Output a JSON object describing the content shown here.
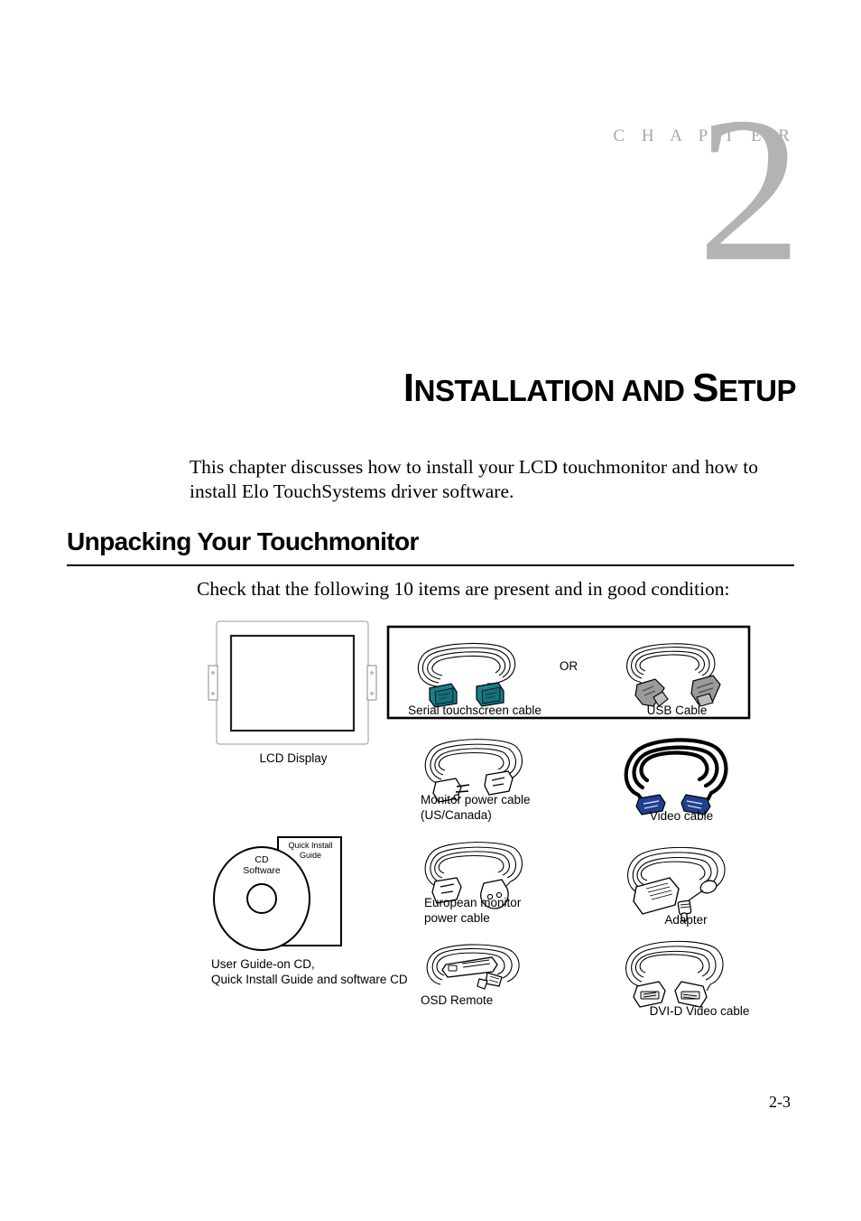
{
  "document": {
    "chapter_label": "C H A P T E R",
    "chapter_number": "2",
    "chapter_title_part1": "I",
    "chapter_title_part1_rest": "NSTALLATION AND ",
    "chapter_title_part2": "S",
    "chapter_title_part2_rest": "ETUP",
    "chapter_title_full": "INSTALLATION AND SETUP",
    "intro_paragraph": "This chapter discusses how to install your LCD touchmonitor and how to install Elo TouchSystems driver software.",
    "section_heading": "Unpacking Your Touchmonitor",
    "check_line": "Check that the following 10 items are present and in good condition:",
    "page_number": "2-3"
  },
  "illustration": {
    "or_label": "OR",
    "items": [
      {
        "id": "lcd-display",
        "caption": "LCD Display"
      },
      {
        "id": "serial-cable",
        "caption": "Serial touchscreen cable"
      },
      {
        "id": "usb-cable",
        "caption": "USB Cable"
      },
      {
        "id": "monitor-power",
        "caption": "Monitor power cable\n(US/Canada)"
      },
      {
        "id": "video-cable",
        "caption": "Video cable"
      },
      {
        "id": "european-power",
        "caption": "European monitor\npower cable"
      },
      {
        "id": "adapter",
        "caption": "Adapter"
      },
      {
        "id": "osd-remote",
        "caption": "OSD Remote"
      },
      {
        "id": "dvi-cable",
        "caption": "DVI-D Video cable"
      },
      {
        "id": "cd-software",
        "caption": "User Guide-on CD,\nQuick Install Guide and software CD"
      }
    ],
    "cd_disc_label": "CD\nSoftware",
    "booklet_label": "Quick Install Guide"
  },
  "colors": {
    "chapter_gray": "#b3b3b3",
    "serial_connector_teal": "#1a7f8c",
    "usb_connector_gray": "#9a9a9a",
    "video_connector_blue": "#1f3f8f",
    "line_black": "#000000"
  }
}
